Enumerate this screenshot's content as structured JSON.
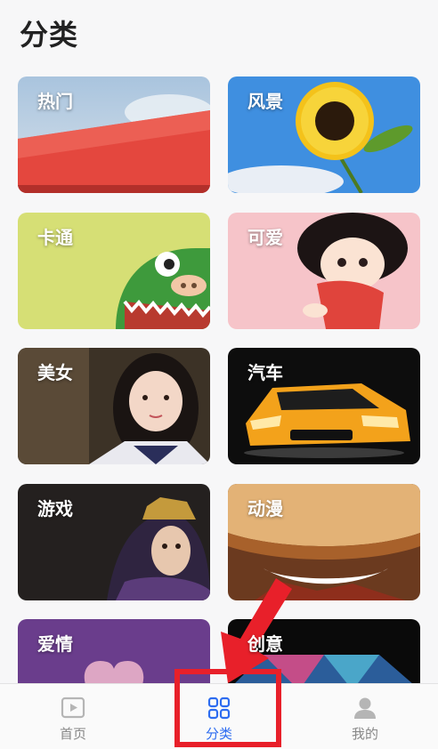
{
  "page": {
    "title": "分类"
  },
  "categories": [
    {
      "label": "热门"
    },
    {
      "label": "风景"
    },
    {
      "label": "卡通"
    },
    {
      "label": "可爱"
    },
    {
      "label": "美女"
    },
    {
      "label": "汽车"
    },
    {
      "label": "游戏"
    },
    {
      "label": "动漫"
    },
    {
      "label": "爱情"
    },
    {
      "label": "创意"
    }
  ],
  "tabbar": {
    "tabs": [
      {
        "label": "首页",
        "icon": "play-icon",
        "active": false
      },
      {
        "label": "分类",
        "icon": "grid-icon",
        "active": true
      },
      {
        "label": "我的",
        "icon": "person-icon",
        "active": false
      }
    ]
  },
  "colors": {
    "accent": "#2d6cf0",
    "annotation": "#e8202a",
    "inactive": "#888888"
  }
}
